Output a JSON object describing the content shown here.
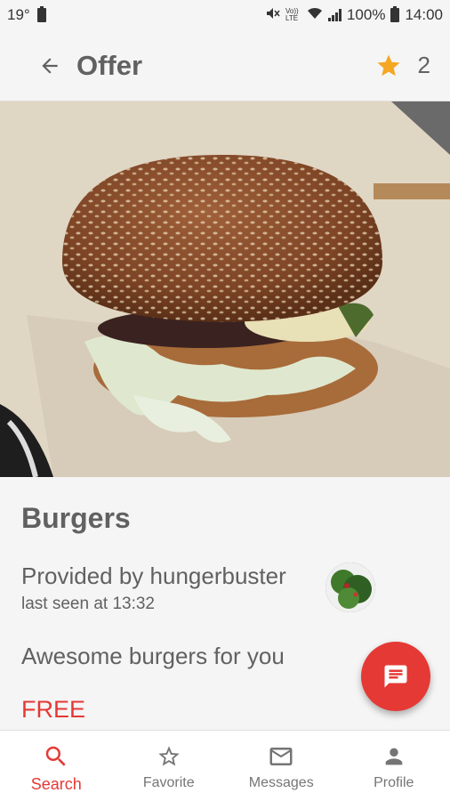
{
  "status_bar": {
    "temperature": "19°",
    "volte_label": "Vo)) LTE",
    "battery_percent": "100%",
    "time": "14:00"
  },
  "app_bar": {
    "title": "Offer",
    "rating_count": "2",
    "back_icon": "arrow-back-icon",
    "star_icon": "star-icon",
    "star_color": "#f5a623"
  },
  "offer": {
    "title": "Burgers",
    "provider": "Provided by hungerbuster",
    "last_seen": "last seen at 13:32",
    "description": "Awesome burgers for you",
    "price": "FREE"
  },
  "fab": {
    "icon": "chat-icon",
    "color": "#e53935"
  },
  "bottom_nav": {
    "items": [
      {
        "label": "Search",
        "icon": "search-icon",
        "active": true
      },
      {
        "label": "Favorite",
        "icon": "star-outline-icon",
        "active": false
      },
      {
        "label": "Messages",
        "icon": "mail-icon",
        "active": false
      },
      {
        "label": "Profile",
        "icon": "person-icon",
        "active": false
      }
    ]
  },
  "colors": {
    "accent": "#e53935",
    "text": "#616161",
    "background": "#f5f5f5"
  }
}
